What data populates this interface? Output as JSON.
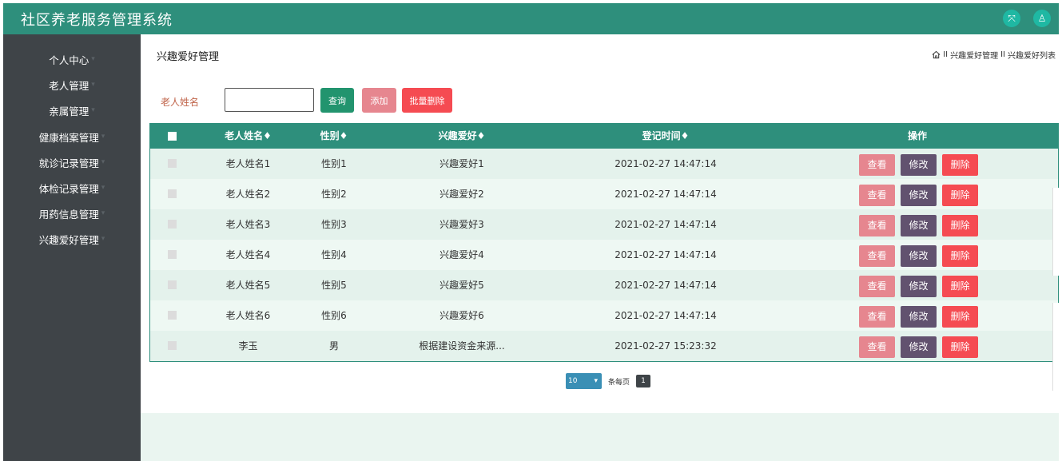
{
  "app": {
    "title": "社区养老服务管理系统"
  },
  "header_icons": [
    {
      "name": "fullscreen-icon",
      "glyph": "⤧"
    },
    {
      "name": "user-icon",
      "glyph": "♙"
    }
  ],
  "sidebar": {
    "items": [
      {
        "label": "个人中心"
      },
      {
        "label": "老人管理"
      },
      {
        "label": "亲属管理"
      },
      {
        "label": "健康档案管理"
      },
      {
        "label": "就诊记录管理"
      },
      {
        "label": "体检记录管理"
      },
      {
        "label": "用药信息管理"
      },
      {
        "label": "兴趣爱好管理"
      }
    ]
  },
  "page": {
    "heading": "兴趣爱好管理",
    "breadcrumb": [
      "兴趣爱好管理",
      "兴趣爱好列表"
    ],
    "breadcrumb_sep": "II"
  },
  "search": {
    "label": "老人姓名",
    "value": "",
    "query_button": "查询",
    "add_button": "添加",
    "batch_delete_button": "批量删除"
  },
  "table": {
    "columns": [
      "老人姓名",
      "性别",
      "兴趣爱好",
      "登记时间",
      "操作"
    ],
    "sort_mark": "♦",
    "rows": [
      {
        "name": "老人姓名1",
        "gender": "性别1",
        "hobby": "兴趣爱好1",
        "time": "2021-02-27 14:47:14"
      },
      {
        "name": "老人姓名2",
        "gender": "性别2",
        "hobby": "兴趣爱好2",
        "time": "2021-02-27 14:47:14"
      },
      {
        "name": "老人姓名3",
        "gender": "性别3",
        "hobby": "兴趣爱好3",
        "time": "2021-02-27 14:47:14"
      },
      {
        "name": "老人姓名4",
        "gender": "性别4",
        "hobby": "兴趣爱好4",
        "time": "2021-02-27 14:47:14"
      },
      {
        "name": "老人姓名5",
        "gender": "性别5",
        "hobby": "兴趣爱好5",
        "time": "2021-02-27 14:47:14"
      },
      {
        "name": "老人姓名6",
        "gender": "性别6",
        "hobby": "兴趣爱好6",
        "time": "2021-02-27 14:47:14"
      },
      {
        "name": "李玉",
        "gender": "男",
        "hobby": "根据建设资金来源...",
        "time": "2021-02-27 15:23:32"
      }
    ],
    "actions": {
      "view": "查看",
      "edit": "修改",
      "delete": "删除"
    }
  },
  "pagination": {
    "page_size": "10",
    "page_size_label": "条每页",
    "current_page": "1"
  },
  "colors": {
    "primary": "#2e8f7c",
    "sidebar": "#3f4448",
    "view": "#e6868f",
    "edit": "#62526f",
    "delete": "#f54b52"
  }
}
